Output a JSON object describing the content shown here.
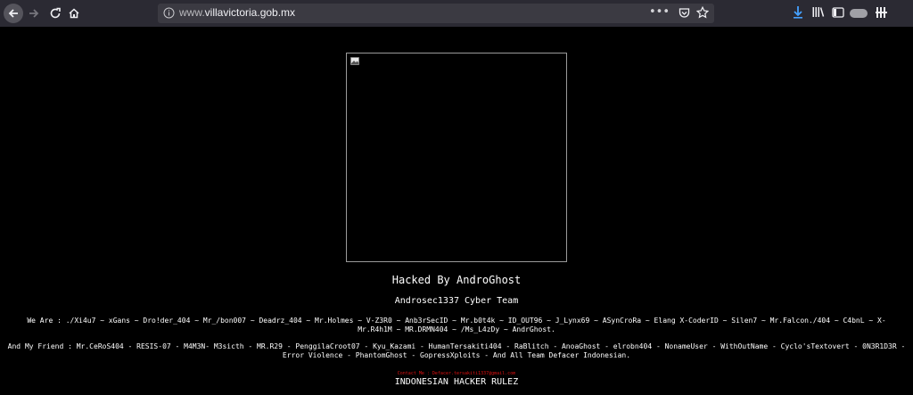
{
  "browser": {
    "url_prefix": "www.",
    "url_host": "villavictoria.gob.mx",
    "menu_dots": "•••",
    "icons": [
      "back-icon",
      "forward-icon",
      "reload-icon",
      "home-icon",
      "info-icon",
      "pocket-icon",
      "star-icon",
      "download-icon",
      "library-icon",
      "sidebar-icon",
      "toggle-icon",
      "menu-icon"
    ]
  },
  "page": {
    "title": "Hacked By AndroGhost",
    "team": "Androsec1337 Cyber Team",
    "we_are": "We Are : ./Xi4u7 ~ xGans ~ Dro!der_404 ~ Mr_/bon007 ~ Deadrz_404 ~ Mr.Holmes ~ V-Z3R0 ~ Anb3rSecID ~ Mr.b0t4k ~ ID_OUT96 ~ J_Lynx69 ~ ASynCroRa ~ Elang X-CoderID ~ Silen7 ~ Mr.Falcon./404 ~ C4bnL ~ X-Mr.R4h1M ~ MR.DRMN404 ~ /Ms_L4zDy ~ AndrGhost.",
    "friends": "And My Friend : Mr.CeRoS404 - RESIS-07 - M4M3N- M3sicth - MR.R29 - PenggilaCroot07 - Kyu_Kazami - HumanTersakiti404 - RaBlitch - AnoaGhost - elrobn404 - NonameUser - WithOutName - Cyclo'sTextovert - 0N3R1D3R - Error Violence - PhantomGhost - GopressXploits - And All Team Defacer Indonesian.",
    "contact": "Contact Me : Defacer.tersakiti1337@gmail.com",
    "rulez": "INDONESIAN HACKER RULEZ"
  },
  "colors": {
    "background": "#000000",
    "toolbar": "#2b2a33",
    "contact": "#dd1111"
  }
}
